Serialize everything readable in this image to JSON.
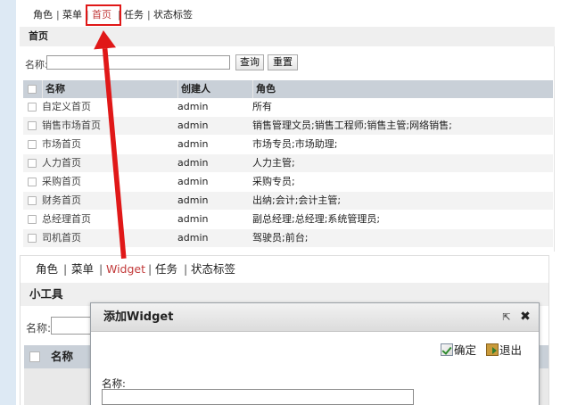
{
  "top": {
    "tabs": [
      {
        "label": "角色"
      },
      {
        "label": "菜单"
      },
      {
        "label": "首页"
      },
      {
        "label": "任务"
      },
      {
        "label": "状态标签"
      }
    ],
    "separator": "|",
    "section_title": "首页",
    "search": {
      "label": "名称:",
      "value": "",
      "query_button": "查询",
      "reset_button": "重置"
    },
    "columns": [
      "名称",
      "创建人",
      "角色"
    ],
    "rows": [
      {
        "name": "自定义首页",
        "creator": "admin",
        "roles": "所有"
      },
      {
        "name": "销售市场首页",
        "creator": "admin",
        "roles": "销售管理文员;销售工程师;销售主管;网络销售;"
      },
      {
        "name": "市场首页",
        "creator": "admin",
        "roles": "市场专员;市场助理;"
      },
      {
        "name": "人力首页",
        "creator": "admin",
        "roles": "人力主管;"
      },
      {
        "name": "采购首页",
        "creator": "admin",
        "roles": "采购专员;"
      },
      {
        "name": "财务首页",
        "creator": "admin",
        "roles": "出纳;会计;会计主管;"
      },
      {
        "name": "总经理首页",
        "creator": "admin",
        "roles": "副总经理;总经理;系统管理员;"
      },
      {
        "name": "司机首页",
        "creator": "admin",
        "roles": "驾驶员;前台;"
      }
    ]
  },
  "bottom": {
    "tabs": [
      {
        "label": "角色"
      },
      {
        "label": "菜单"
      },
      {
        "label": "Widget"
      },
      {
        "label": "任务"
      },
      {
        "label": "状态标签"
      }
    ],
    "separator": "|",
    "section_title": "小工具",
    "search_label": "名称:",
    "column_name": "名称",
    "dialog": {
      "title": "添加Widget",
      "popout_icon": "popout-icon",
      "close_icon": "close-icon",
      "ok_label": "确定",
      "exit_label": "退出",
      "field_label": "名称:",
      "field_value": ""
    }
  },
  "colors": {
    "active_tab": "#c23a3a",
    "highlight": "#e01818",
    "grid_header": "#c9d0d8",
    "left_strip": "#dde9f4"
  }
}
